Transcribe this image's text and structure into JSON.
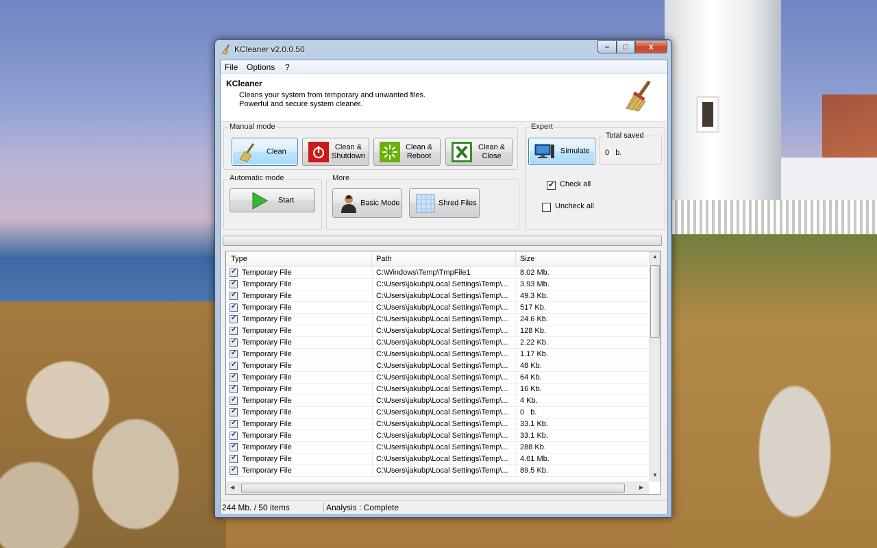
{
  "window": {
    "title": "KCleaner v2.0.0.50",
    "controls": {
      "minimize": "–",
      "maximize": "□",
      "close": "x"
    }
  },
  "menu": [
    "File",
    "Options",
    "?"
  ],
  "header": {
    "title": "KCleaner",
    "line1": "Cleans your system from temporary and unwanted files.",
    "line2": "Powerful and secure system cleaner."
  },
  "manual_mode": {
    "label": "Manual mode",
    "buttons": {
      "clean": "Clean",
      "clean_shutdown_1": "Clean &",
      "clean_shutdown_2": "Shutdown",
      "clean_reboot_1": "Clean &",
      "clean_reboot_2": "Reboot",
      "clean_close_1": "Clean &",
      "clean_close_2": "Close"
    }
  },
  "expert": {
    "label": "Expert",
    "simulate": "Simulate"
  },
  "total_saved": {
    "label": "Total saved",
    "value": "0   b."
  },
  "automatic_mode": {
    "label": "Automatic mode",
    "start": "Start"
  },
  "more": {
    "label": "More",
    "basic_mode": "Basic Mode",
    "shred_files": "Shred Files"
  },
  "check_all": {
    "label": "Check all",
    "checked": true
  },
  "uncheck_all": {
    "label": "Uncheck all",
    "checked": false
  },
  "list": {
    "columns": [
      "Type",
      "Path",
      "Size"
    ],
    "rows": [
      {
        "type": "Temporary File",
        "path": "C:\\Windows\\Temp\\TmpFile1",
        "size": "8.02 Mb.",
        "checked": true
      },
      {
        "type": "Temporary File",
        "path": "C:\\Users\\jakubp\\Local Settings\\Temp\\...",
        "size": "3.93 Mb.",
        "checked": true
      },
      {
        "type": "Temporary File",
        "path": "C:\\Users\\jakubp\\Local Settings\\Temp\\...",
        "size": "49.3 Kb.",
        "checked": true
      },
      {
        "type": "Temporary File",
        "path": "C:\\Users\\jakubp\\Local Settings\\Temp\\...",
        "size": "517 Kb.",
        "checked": true
      },
      {
        "type": "Temporary File",
        "path": "C:\\Users\\jakubp\\Local Settings\\Temp\\...",
        "size": "24.6 Kb.",
        "checked": true
      },
      {
        "type": "Temporary File",
        "path": "C:\\Users\\jakubp\\Local Settings\\Temp\\...",
        "size": "128 Kb.",
        "checked": true
      },
      {
        "type": "Temporary File",
        "path": "C:\\Users\\jakubp\\Local Settings\\Temp\\...",
        "size": "2.22 Kb.",
        "checked": true
      },
      {
        "type": "Temporary File",
        "path": "C:\\Users\\jakubp\\Local Settings\\Temp\\...",
        "size": "1.17 Kb.",
        "checked": true
      },
      {
        "type": "Temporary File",
        "path": "C:\\Users\\jakubp\\Local Settings\\Temp\\...",
        "size": "48 Kb.",
        "checked": true
      },
      {
        "type": "Temporary File",
        "path": "C:\\Users\\jakubp\\Local Settings\\Temp\\...",
        "size": "64 Kb.",
        "checked": true
      },
      {
        "type": "Temporary File",
        "path": "C:\\Users\\jakubp\\Local Settings\\Temp\\...",
        "size": "16 Kb.",
        "checked": true
      },
      {
        "type": "Temporary File",
        "path": "C:\\Users\\jakubp\\Local Settings\\Temp\\...",
        "size": "4 Kb.",
        "checked": true
      },
      {
        "type": "Temporary File",
        "path": "C:\\Users\\jakubp\\Local Settings\\Temp\\...",
        "size": "0   b.",
        "checked": true
      },
      {
        "type": "Temporary File",
        "path": "C:\\Users\\jakubp\\Local Settings\\Temp\\...",
        "size": "33.1 Kb.",
        "checked": true
      },
      {
        "type": "Temporary File",
        "path": "C:\\Users\\jakubp\\Local Settings\\Temp\\...",
        "size": "33.1 Kb.",
        "checked": true
      },
      {
        "type": "Temporary File",
        "path": "C:\\Users\\jakubp\\Local Settings\\Temp\\...",
        "size": "288 Kb.",
        "checked": true
      },
      {
        "type": "Temporary File",
        "path": "C:\\Users\\jakubp\\Local Settings\\Temp\\...",
        "size": "4.61 Mb.",
        "checked": true
      },
      {
        "type": "Temporary File",
        "path": "C:\\Users\\jakubp\\Local Settings\\Temp\\...",
        "size": "89.5 Kb.",
        "checked": true
      }
    ]
  },
  "status": {
    "summary": "244 Mb. / 50 items",
    "analysis": "Analysis : Complete"
  },
  "icons": {
    "app": "broom-icon",
    "header": "broom-icon",
    "clean": "broom-icon",
    "clean_shutdown": "power-icon",
    "clean_reboot": "reboot-icon",
    "clean_close": "close-x-icon",
    "simulate": "computer-icon",
    "start": "play-icon",
    "basic_mode": "user-icon",
    "shred_files": "shredder-icon"
  },
  "colors": {
    "accent_selected": "#bee6fd",
    "shutdown_red": "#d01818",
    "reboot_green": "#6ab20a",
    "close_green": "#3c8f2c",
    "start_green": "#3ab53a"
  }
}
